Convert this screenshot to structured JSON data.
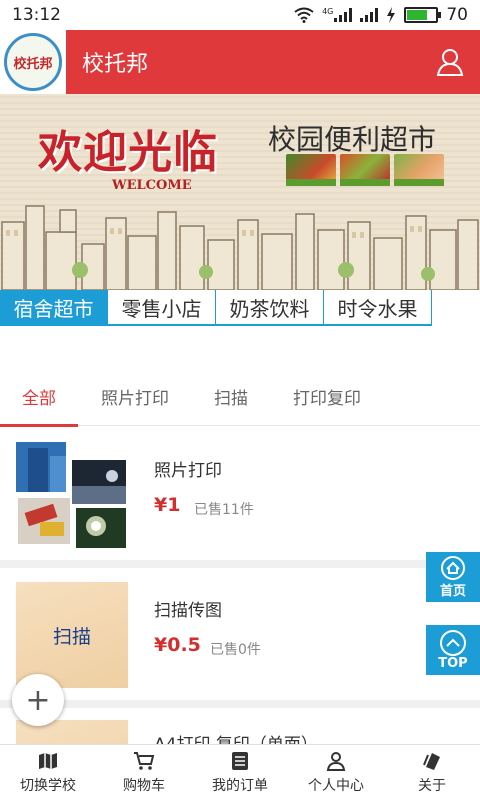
{
  "status_bar": {
    "time": "13:12",
    "network": "4G",
    "battery": "70",
    "battery_level": 0.7
  },
  "header": {
    "logo_text": "校托邦",
    "title": "校托邦",
    "user_icon": "user-icon"
  },
  "banner": {
    "headline": "欢迎光临",
    "welcome": "WELCOME",
    "market": "校园便利超市"
  },
  "categories": [
    {
      "label": "宿舍超市",
      "active": true
    },
    {
      "label": "零售小店",
      "active": false
    },
    {
      "label": "奶茶饮料",
      "active": false
    },
    {
      "label": "时令水果",
      "active": false
    }
  ],
  "sub_tabs": [
    {
      "label": "全部",
      "active": true
    },
    {
      "label": "照片打印",
      "active": false
    },
    {
      "label": "扫描",
      "active": false
    },
    {
      "label": "打印复印",
      "active": false
    }
  ],
  "products": [
    {
      "name": "照片打印",
      "price": "¥1",
      "sold": "已售11件"
    },
    {
      "name": "扫描传图",
      "price": "¥0.5",
      "sold": "已售0件",
      "image_text": "扫描"
    },
    {
      "name": "A4打印 复印（单面）"
    }
  ],
  "floating": {
    "home_label": "首页",
    "top_label": "TOP",
    "add_label": "+"
  },
  "bottom_nav": [
    {
      "label": "切换学校",
      "icon": "map-icon"
    },
    {
      "label": "购物车",
      "icon": "cart-icon"
    },
    {
      "label": "我的订单",
      "icon": "orders-icon"
    },
    {
      "label": "个人中心",
      "icon": "person-icon"
    },
    {
      "label": "关于",
      "icon": "about-icon"
    }
  ],
  "colors": {
    "header_red": "#e0393b",
    "tab_blue": "#1c9dd6",
    "price_red": "#d32f2f"
  }
}
